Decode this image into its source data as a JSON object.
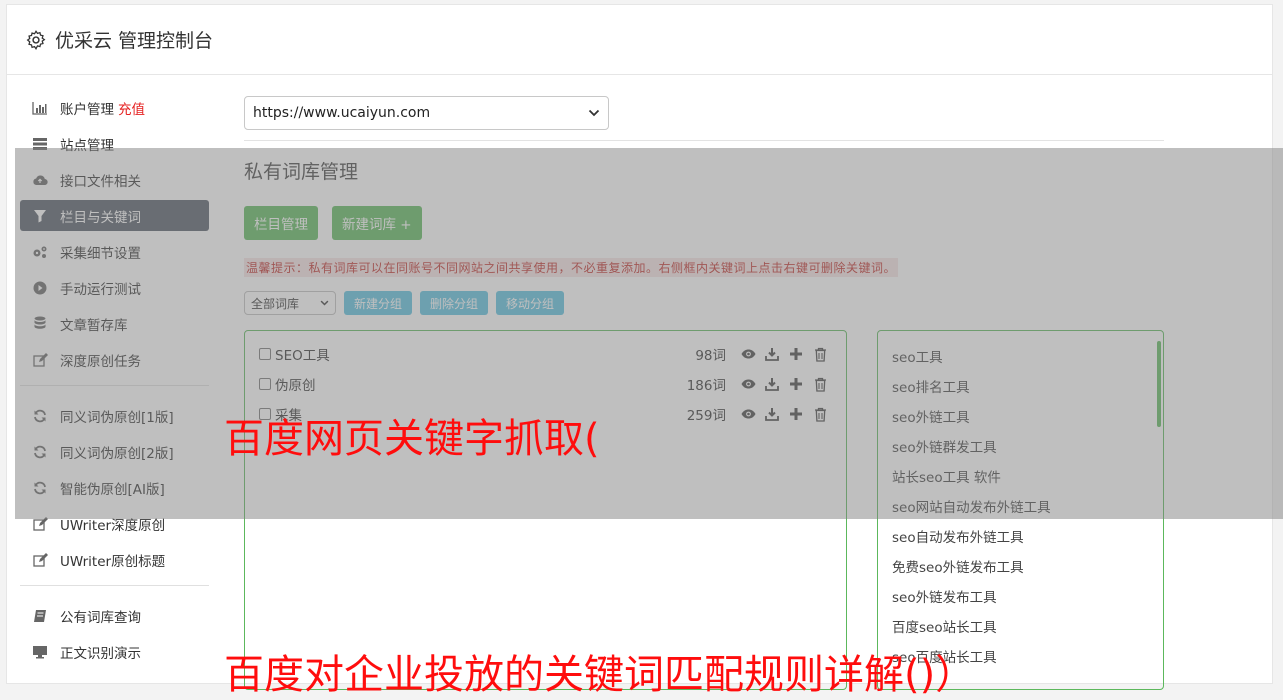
{
  "app": {
    "title": "优采云 管理控制台"
  },
  "sidebar": {
    "charge_label": "充值",
    "items": [
      {
        "label": "账户管理",
        "icon": "bar-chart-icon"
      },
      {
        "label": "站点管理",
        "icon": "server-icon"
      },
      {
        "label": "接口文件相关",
        "icon": "cloud-upload-icon"
      },
      {
        "label": "栏目与关键词",
        "icon": "filter-icon",
        "active": true
      },
      {
        "label": "采集细节设置",
        "icon": "gears-icon"
      },
      {
        "label": "手动运行测试",
        "icon": "play-circle-icon"
      },
      {
        "label": "文章暂存库",
        "icon": "database-icon"
      },
      {
        "label": "深度原创任务",
        "icon": "edit-icon"
      },
      {
        "label": "同义词伪原创[1版]",
        "icon": "refresh-icon"
      },
      {
        "label": "同义词伪原创[2版]",
        "icon": "refresh-icon"
      },
      {
        "label": "智能伪原创[AI版]",
        "icon": "refresh-icon"
      },
      {
        "label": "UWriter深度原创",
        "icon": "edit-icon"
      },
      {
        "label": "UWriter原创标题",
        "icon": "edit-icon"
      },
      {
        "label": "公有词库查询",
        "icon": "book-icon"
      },
      {
        "label": "正文识别演示",
        "icon": "monitor-icon"
      }
    ]
  },
  "main": {
    "site_select": {
      "value": "https://www.ucaiyun.com"
    },
    "section_title": "私有词库管理",
    "buttons": {
      "column_manage": "栏目管理",
      "new_library": "新建词库 +"
    },
    "tip": "温馨提示：私有词库可以在同账号不同网站之间共享使用，不必重复添加。右侧框内关键词上点击右键可删除关键词。",
    "group_select": {
      "value": "全部词库"
    },
    "group_buttons": {
      "new": "新建分组",
      "delete": "删除分组",
      "move": "移动分组"
    },
    "libraries": [
      {
        "name": "SEO工具",
        "count": "98词"
      },
      {
        "name": "伪原创",
        "count": "186词"
      },
      {
        "name": "采集",
        "count": "259词"
      }
    ],
    "keywords": [
      "seo工具",
      "seo排名工具",
      "seo外链工具",
      "seo外链群发工具",
      "站长seo工具 软件",
      "seo网站自动发布外链工具",
      "seo自动发布外链工具",
      "免费seo外链发布工具",
      "seo外链发布工具",
      "百度seo站长工具",
      "seo百度站长工具"
    ]
  },
  "watermarks": {
    "line1": "百度网页关键字抓取(",
    "line2": "百度对企业投放的关键词匹配规则详解()）"
  },
  "colors": {
    "active_nav": "#525a66",
    "charge": "#e52020",
    "green_button": "#5cb85c",
    "blue_button": "#5bc0de",
    "tip_text": "#c12e2a",
    "watermark": "#ff0d0d"
  }
}
